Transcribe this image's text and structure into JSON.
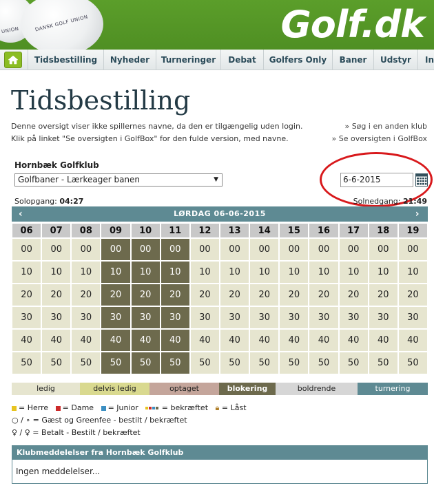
{
  "banner": {
    "logo": "Golf.dk",
    "ball_text_1": "DANSK GOLF UNION",
    "ball_text_2": "UNION"
  },
  "nav": {
    "home_icon": "home-icon",
    "items": [
      "Tidsbestilling",
      "Nyheder",
      "Turneringer",
      "Debat",
      "Golfers Only",
      "Baner",
      "Udstyr",
      "In"
    ]
  },
  "page": {
    "title": "Tidsbestilling",
    "intro_1": "Denne oversigt viser ikke spillernes navne, da den er tilgængelig uden login.",
    "intro_2": "Klik på linket \"Se oversigten i GolfBox\" for den fulde version, med navne.",
    "link_other_club": "» Søg i en anden klub",
    "link_golfbox": "» Se oversigten i GolfBox"
  },
  "booking": {
    "club_name": "Hornbæk Golfklub",
    "course_selected": "Golfbaner - Lærkeager banen",
    "date_value": "6-6-2015",
    "sunrise_label": "Solopgang:",
    "sunrise_time": "04:27",
    "sunset_label": "Solnedgang:",
    "sunset_time": "21:49",
    "day_title": "LØRDAG 06-06-2015",
    "prev_arrow": "‹",
    "next_arrow": "›"
  },
  "timetable": {
    "hours": [
      "06",
      "07",
      "08",
      "09",
      "10",
      "11",
      "12",
      "13",
      "14",
      "15",
      "16",
      "17",
      "18",
      "19"
    ],
    "minutes": [
      "00",
      "10",
      "20",
      "30",
      "40",
      "50"
    ],
    "blocked_hours": [
      "09",
      "10",
      "11"
    ]
  },
  "legend": {
    "items": [
      {
        "label": "ledig",
        "color": "#e6e5cf"
      },
      {
        "label": "delvis ledig",
        "color": "#d9d98f"
      },
      {
        "label": "optaget",
        "color": "#c4a59b"
      },
      {
        "label": "blokering",
        "color": "#6d6a4d"
      },
      {
        "label": "boldrende",
        "color": "#d6d6d6"
      },
      {
        "label": "turnering",
        "color": "#5e8a93"
      }
    ]
  },
  "key": {
    "herre": "= Herre",
    "dame": "= Dame",
    "junior": "= Junior",
    "bekraeftet": "= bekræftet",
    "laast": "= Låst",
    "gaest": "○ / ∘ = Gæst og Greenfee - bestilt / bekræftet",
    "betalt": "♀ / ♀ = Betalt - Bestilt / bekræftet",
    "colors": {
      "herre": "#e8c420",
      "dame": "#cc2a2a",
      "junior": "#3c8fc2"
    }
  },
  "messages": {
    "header": "Klubmeddelelser fra Hornbæk Golfklub",
    "body": "Ingen meddelelser..."
  }
}
